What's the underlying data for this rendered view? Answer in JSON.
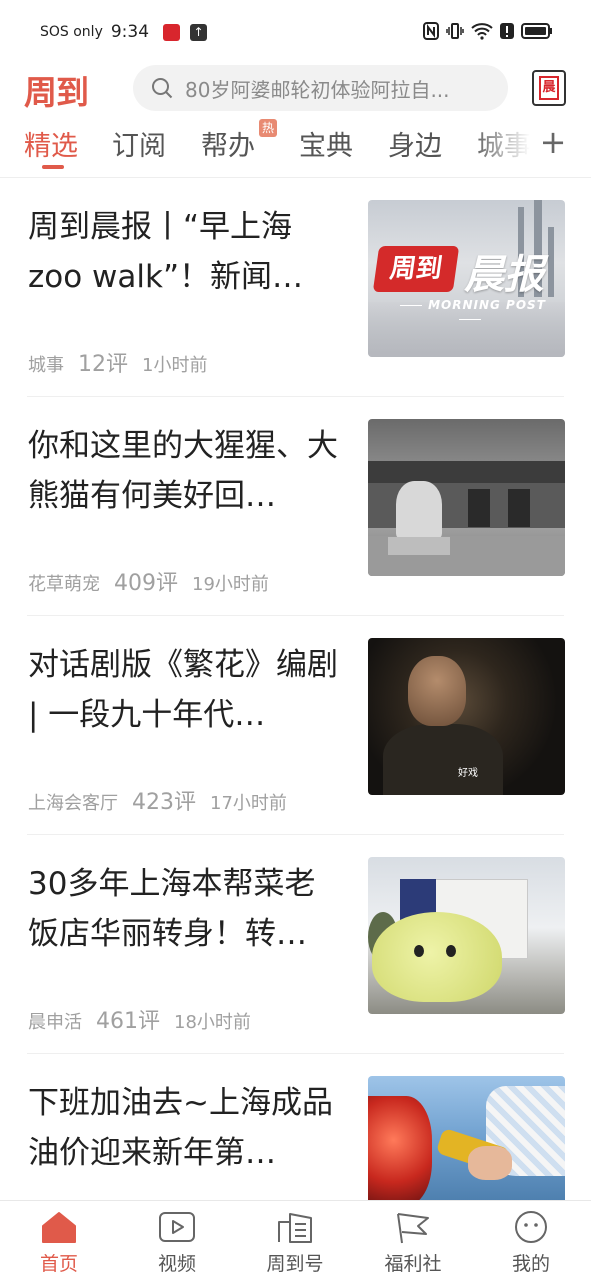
{
  "status_bar": {
    "carrier": "SOS only",
    "time": "9:34",
    "up_arrow": "↑"
  },
  "header": {
    "logo": "周到",
    "search_placeholder": "80岁阿婆邮轮初体验阿拉自...",
    "morning_button": "晨"
  },
  "tabs": [
    {
      "label": "精选",
      "active": true
    },
    {
      "label": "订阅"
    },
    {
      "label": "帮办",
      "badge": "热"
    },
    {
      "label": "宝典"
    },
    {
      "label": "身边"
    },
    {
      "label": "城事"
    }
  ],
  "tabs_add": "+",
  "feed": [
    {
      "title": "周到晨报丨“早上海zoo walk”！新闻…",
      "category": "城事",
      "comments": "12评",
      "time": "1小时前",
      "thumb_logo": "周到",
      "thumb_word": "晨报",
      "thumb_sub": "MORNING POST"
    },
    {
      "title": "你和这里的大猩猩、大熊猫有何美好回…",
      "category": "花草萌宠",
      "comments": "409评",
      "time": "19小时前"
    },
    {
      "title": "对话剧版《繁花》编剧 | 一段九十年代…",
      "category": "上海会客厅",
      "comments": "423评",
      "time": "17小时前",
      "thumb_caption": "好戏"
    },
    {
      "title": "30多年上海本帮菜老饭店华丽转身！转…",
      "category": "晨申活",
      "comments": "461评",
      "time": "18小时前"
    },
    {
      "title": "下班加油去~上海成品油价迎来新年第…",
      "category": "",
      "comments": "",
      "time": ""
    }
  ],
  "bottom_nav": [
    {
      "label": "首页",
      "icon": "home-icon",
      "active": true
    },
    {
      "label": "视频",
      "icon": "video-icon"
    },
    {
      "label": "周到号",
      "icon": "building-icon"
    },
    {
      "label": "福利社",
      "icon": "flag-icon"
    },
    {
      "label": "我的",
      "icon": "profile-face-icon"
    }
  ],
  "colors": {
    "accent": "#e05a4a",
    "text": "#222222",
    "meta": "#a0a0a0"
  }
}
